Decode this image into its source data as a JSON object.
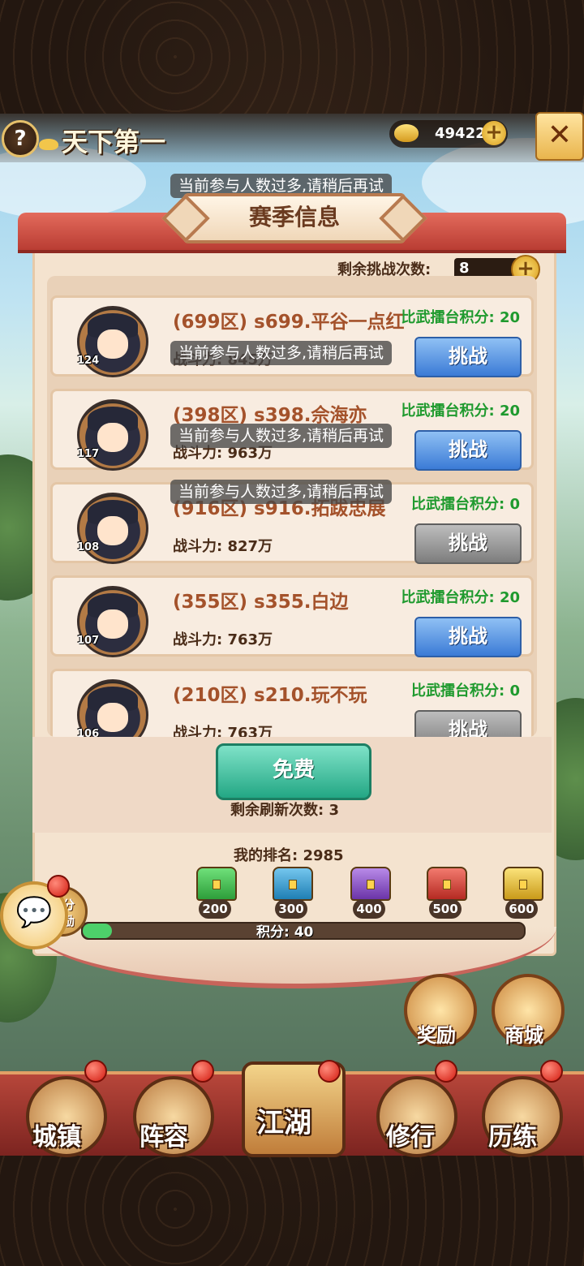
{
  "header": {
    "title": "天下第一",
    "help_label": "?",
    "gold_amount": "49422",
    "gold_plus": "+",
    "close_label": "✕"
  },
  "toast": "当前参与人数过多,请稍后再试",
  "season_title": "赛季信息",
  "remaining_challenges": {
    "label": "剩余挑战次数:",
    "value": "8",
    "plus": "+"
  },
  "opponents": [
    {
      "level": "124",
      "name": "(699区) s699.平谷一点红",
      "power": "战斗力: 845万",
      "score": "比武擂台积分: 20",
      "button": "挑战",
      "enabled": true
    },
    {
      "level": "117",
      "name": "(398区) s398.佘海亦",
      "power": "战斗力: 963万",
      "score": "比武擂台积分: 20",
      "button": "挑战",
      "enabled": true
    },
    {
      "level": "108",
      "name": "(916区) s916.拓跋忠展",
      "power": "战斗力: 827万",
      "score": "比武擂台积分: 0",
      "button": "挑战",
      "enabled": false
    },
    {
      "level": "107",
      "name": "(355区) s355.白边",
      "power": "战斗力: 763万",
      "score": "比武擂台积分: 20",
      "button": "挑战",
      "enabled": true
    },
    {
      "level": "106",
      "name": "(210区) s210.玩不玩",
      "power": "战斗力: 763万",
      "score": "比武擂台积分: 0",
      "button": "挑战",
      "enabled": false
    }
  ],
  "free_button": "免费",
  "refresh_remaining": "剩余刷新次数: 3",
  "my_rank": "我的排名: 2985",
  "reward_badge": "积分\n奖励",
  "chests": [
    {
      "threshold": "200",
      "color": "#3fbf4a"
    },
    {
      "threshold": "300",
      "color": "#2c9bd0"
    },
    {
      "threshold": "400",
      "color": "#8a49c6"
    },
    {
      "threshold": "500",
      "color": "#d8403a"
    },
    {
      "threshold": "600",
      "color": "#e8c23a"
    }
  ],
  "score_progress": {
    "label": "积分: 40",
    "value": 40,
    "max": 600
  },
  "side_buttons": {
    "reward": "奖励",
    "shop": "商城"
  },
  "nav": [
    "城镇",
    "阵容",
    "江湖",
    "修行",
    "历练"
  ],
  "colors": {
    "accent_red": "#b93d33",
    "challenge_blue": "#3b7bd6",
    "score_green": "#1f9a2e",
    "free_green": "#23a784"
  }
}
